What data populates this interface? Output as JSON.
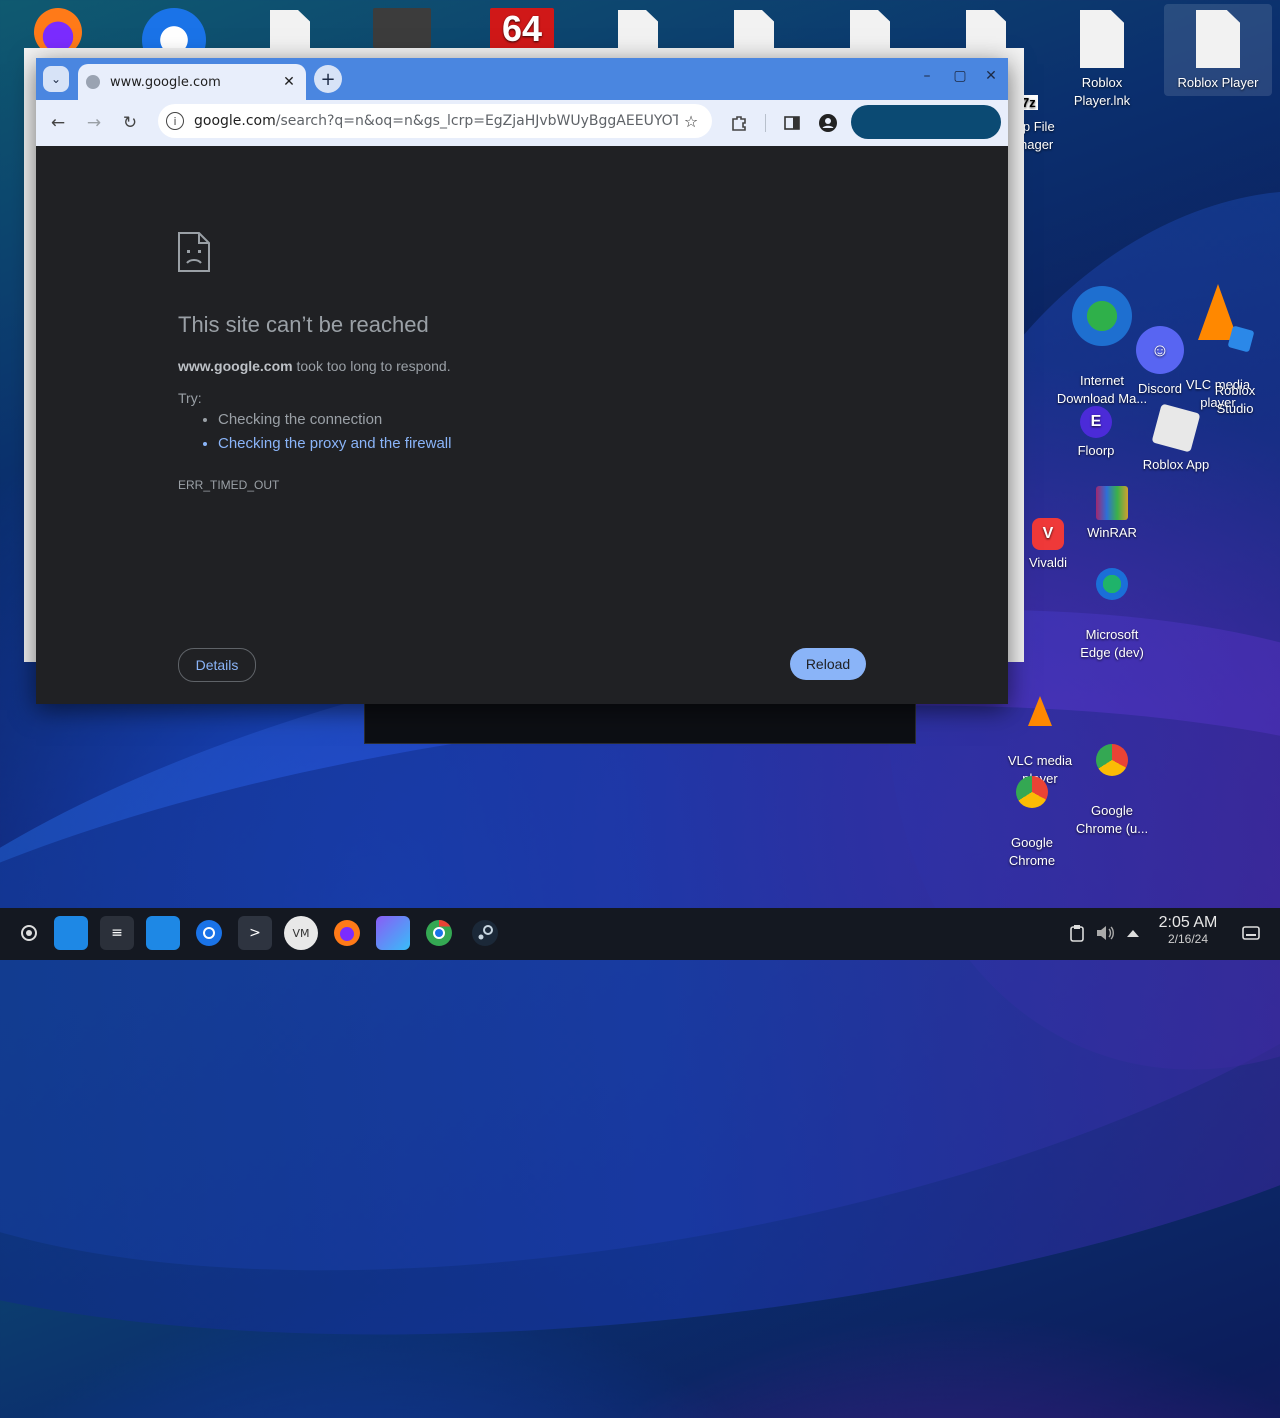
{
  "desktop": {
    "icons": [
      {
        "label": "Roblox Player.lnk"
      },
      {
        "label": "Roblox Player"
      },
      {
        "label": "ip File\nnager"
      },
      {
        "label": "Internet\nDownload Ma..."
      },
      {
        "label": "VLC media\nplayer"
      },
      {
        "label": "Roblox\nStudio"
      },
      {
        "label": "Discord"
      },
      {
        "label": "Floorp"
      },
      {
        "label": "Roblox App"
      },
      {
        "label": "WinRAR"
      },
      {
        "label": "Vivaldi"
      },
      {
        "label": "Microsoft\nEdge (dev)"
      },
      {
        "label": "VLC media\nplayer"
      },
      {
        "label": "Google\nChrome (u..."
      },
      {
        "label": "Google\nChrome"
      }
    ],
    "top_icon_text": "64",
    "seven_zip_text": "7z"
  },
  "browser": {
    "tab_title": "www.google.com",
    "url_host": "google.com",
    "url_rest": "/search?q=n&oq=n&gs_lcrp=EgZjaHJvbWUyBggAEEUYOTI...",
    "error": {
      "title": "This site can’t be reached",
      "host": "www.google.com",
      "message": " took too long to respond.",
      "try": "Try:",
      "suggestions": [
        "Checking the connection",
        "Checking the proxy and the firewall"
      ],
      "code": "ERR_TIMED_OUT",
      "details_label": "Details",
      "reload_label": "Reload"
    }
  },
  "taskbar": {
    "time": "2:05 AM",
    "date": "2/16/24"
  },
  "icons": {
    "back": "←",
    "forward": "→",
    "reload": "↻",
    "star": "☆",
    "new_tab": "+",
    "close": "✕",
    "minimize": "–",
    "maximize": "▢",
    "dropdown": "⌄"
  }
}
